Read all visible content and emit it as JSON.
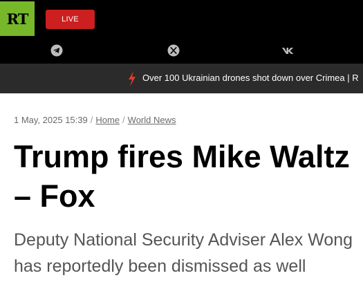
{
  "header": {
    "logo_text": "RT",
    "live_label": "LIVE",
    "social_icons": [
      "telegram-icon",
      "x-icon",
      "vk-icon"
    ]
  },
  "ticker": {
    "text": "Over 100 Ukrainian drones shot down over Crimea | R"
  },
  "article": {
    "date": "1 May, 2025 15:39",
    "breadcrumbs": [
      "Home",
      "World News"
    ],
    "headline": "Trump fires Mike Waltz – Fox",
    "lead": "Deputy National Security Adviser Alex Wong has reportedly been dismissed as well"
  },
  "colors": {
    "brand_green": "#77b82a",
    "live_red": "#cc1f1f",
    "topbar": "#000000",
    "ticker_bg": "#2b2b2b",
    "bolt_red": "#e8382c"
  }
}
